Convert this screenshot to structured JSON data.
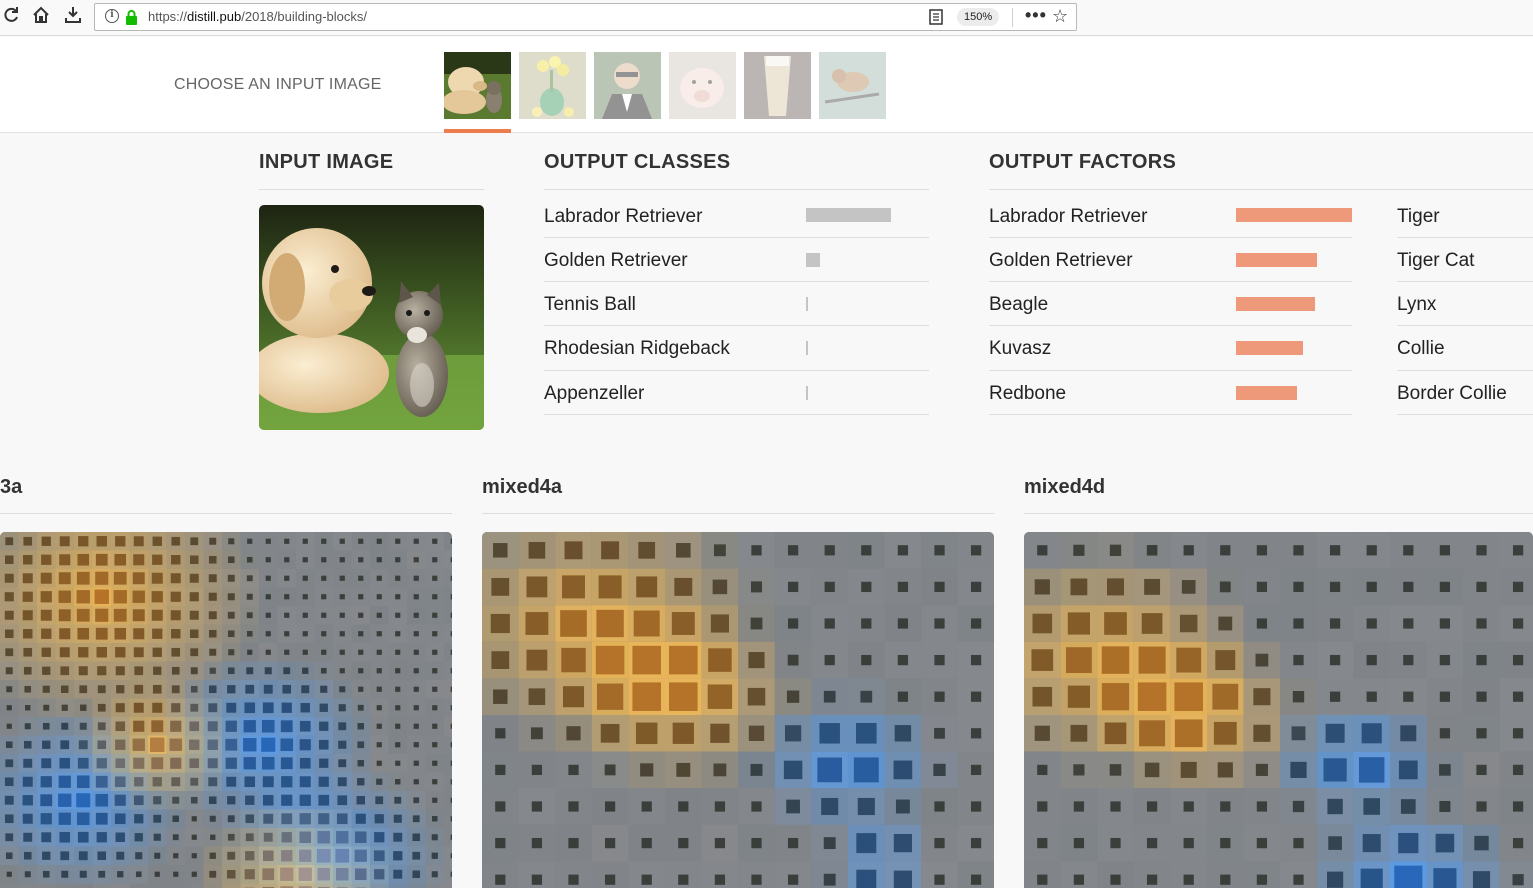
{
  "browser": {
    "url_prefix": "https://",
    "url_host": "distill.pub",
    "url_path": "/2018/building-blocks/",
    "zoom": "150%"
  },
  "chooser": {
    "label": "CHOOSE AN INPUT IMAGE",
    "thumbnails": [
      "dog-and-cat",
      "flower-vase",
      "man-in-tuxedo",
      "pig",
      "glass",
      "bird"
    ]
  },
  "sections": {
    "input_image": "INPUT IMAGE",
    "output_classes": "OUTPUT CLASSES",
    "output_factors": "OUTPUT FACTORS"
  },
  "output_classes": [
    {
      "label": "Labrador Retriever",
      "score": 0.85
    },
    {
      "label": "Golden Retriever",
      "score": 0.14
    },
    {
      "label": "Tennis Ball",
      "score": 0.02
    },
    {
      "label": "Rhodesian Ridgeback",
      "score": 0.02
    },
    {
      "label": "Appenzeller",
      "score": 0.015
    }
  ],
  "output_factors": [
    {
      "label": "Labrador Retriever",
      "score": 1.0
    },
    {
      "label": "Golden Retriever",
      "score": 0.7
    },
    {
      "label": "Beagle",
      "score": 0.68
    },
    {
      "label": "Kuvasz",
      "score": 0.58
    },
    {
      "label": "Redbone",
      "score": 0.53
    }
  ],
  "output_factors_2": [
    {
      "label": "Tiger"
    },
    {
      "label": "Tiger Cat"
    },
    {
      "label": "Lynx"
    },
    {
      "label": "Collie"
    },
    {
      "label": "Border Collie"
    }
  ],
  "layers": [
    {
      "name": "3a"
    },
    {
      "name": "mixed4a"
    },
    {
      "name": "mixed4d"
    }
  ],
  "colors": {
    "accent": "#ee7d4e",
    "factor_bar": "#ee9a7a",
    "class_bar": "#c4c4c4"
  }
}
